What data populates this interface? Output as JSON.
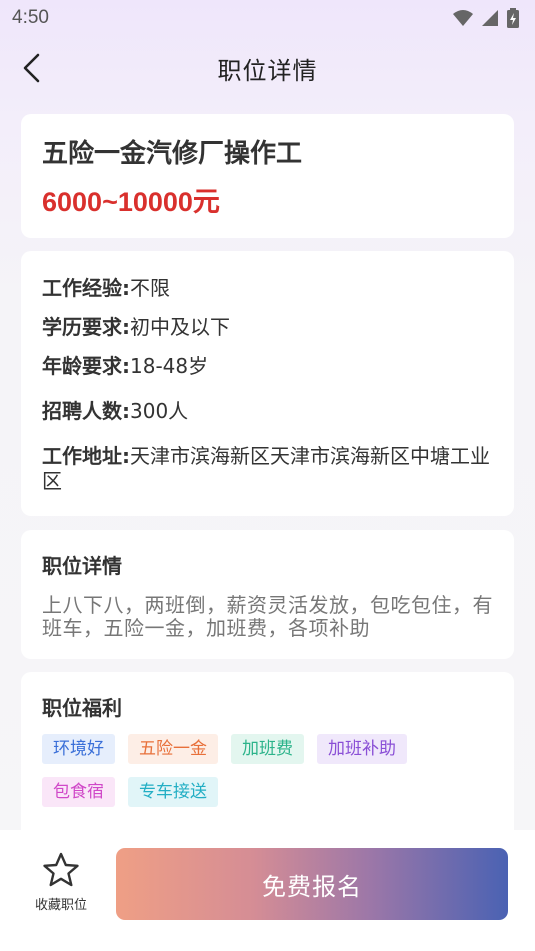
{
  "status_bar": {
    "time": "4:50"
  },
  "nav": {
    "title": "职位详情"
  },
  "job": {
    "title": "五险一金汽修厂操作工",
    "salary": "6000~10000元"
  },
  "info": {
    "rows": [
      {
        "label": "工作经验:",
        "value": "不限"
      },
      {
        "label": "学历要求:",
        "value": "初中及以下"
      },
      {
        "label": "年龄要求:",
        "value": "18-48岁"
      },
      {
        "label": "招聘人数:",
        "value": "300人"
      },
      {
        "label": "工作地址:",
        "value": "天津市滨海新区天津市滨海新区中塘工业区"
      }
    ]
  },
  "description": {
    "title": "职位详情",
    "text": "上八下八，两班倒，薪资灵活发放，包吃包住，有班车，五险一金，加班费，各项补助"
  },
  "welfare": {
    "title": "职位福利",
    "tags": [
      {
        "label": "环境好",
        "color": "#3a6fd8",
        "bg": "#e6eefc"
      },
      {
        "label": "五险一金",
        "color": "#e8703a",
        "bg": "#fdeee6"
      },
      {
        "label": "加班费",
        "color": "#2bb38a",
        "bg": "#e3f6ef"
      },
      {
        "label": "加班补助",
        "color": "#8a4fd6",
        "bg": "#f0e8fb"
      },
      {
        "label": "包食宿",
        "color": "#d048c8",
        "bg": "#fae6f8"
      },
      {
        "label": "专车接送",
        "color": "#22aec4",
        "bg": "#e1f5f8"
      }
    ]
  },
  "bottom": {
    "favorite_label": "收藏职位",
    "signup_label": "免费报名"
  }
}
